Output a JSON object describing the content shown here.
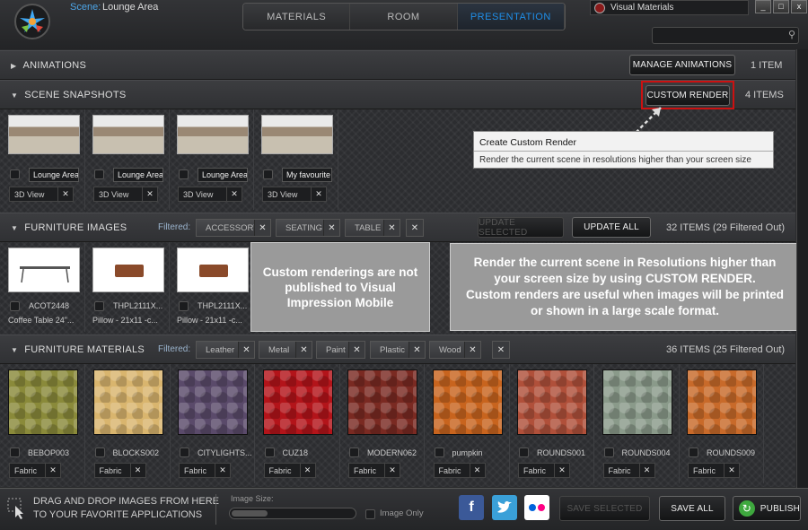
{
  "header": {
    "scene_label": "Scene:",
    "scene_name": "Lounge Area",
    "tabs": [
      "MATERIALS",
      "ROOM",
      "PRESENTATION"
    ],
    "active_tab": "PRESENTATION",
    "app_tab": "Visual Materials",
    "win_buttons": [
      "_",
      "□",
      "x"
    ],
    "search": {
      "placeholder": ""
    }
  },
  "animations": {
    "title": "ANIMATIONS",
    "button": "MANAGE ANIMATIONS",
    "count": "1 ITEM"
  },
  "snapshots": {
    "title": "SCENE SNAPSHOTS",
    "button": "CUSTOM RENDER",
    "count": "4 ITEMS",
    "items": [
      {
        "name": "Lounge Area",
        "view": "3D View"
      },
      {
        "name": "Lounge Area",
        "view": "3D View"
      },
      {
        "name": "Lounge Area",
        "view": "3D View"
      },
      {
        "name": "My favourite",
        "view": "3D View"
      }
    ]
  },
  "tooltip": {
    "title": "Create Custom Render",
    "text": "Render the current scene in resolutions higher than your screen size"
  },
  "furniture_images": {
    "title": "FURNITURE IMAGES",
    "filtered": "Filtered:",
    "filters": [
      "ACCESSORY",
      "SEATING",
      "TABLE"
    ],
    "update_selected": "UPDATE SELECTED",
    "update_all": "UPDATE ALL",
    "count": "32 ITEMS (29 Filtered Out)",
    "items": [
      {
        "code": "ACOT2448",
        "desc": "Coffee Table 24\"..."
      },
      {
        "code": "THPL2111X...",
        "desc": "Pillow - 21x11 -c..."
      },
      {
        "code": "THPL2111X...",
        "desc": "Pillow - 21x11 -c..."
      }
    ]
  },
  "callout_left": "Custom renderings are not published to Visual Impression Mobile",
  "callout_right": "Render the current scene in Resolutions higher than your screen size by using CUSTOM RENDER.\nCustom renders are useful when images will be printed or shown in a large scale format.",
  "furniture_materials": {
    "title": "FURNITURE MATERIALS",
    "filtered": "Filtered:",
    "filters": [
      "Leather",
      "Metal",
      "Paint",
      "Plastic",
      "Wood"
    ],
    "count": "36 ITEMS (25 Filtered Out)",
    "items": [
      {
        "name": "BEBOP003",
        "type": "Fabric",
        "color": "#8a8a3a"
      },
      {
        "name": "BLOCKS002",
        "type": "Fabric",
        "color": "#d9b56e"
      },
      {
        "name": "CITYLIGHTS...",
        "type": "Fabric",
        "color": "#5a4a6a"
      },
      {
        "name": "CUZ18",
        "type": "Fabric",
        "color": "#b3141a"
      },
      {
        "name": "MODERN062",
        "type": "Fabric",
        "color": "#7a2a22"
      },
      {
        "name": "pumpkin",
        "type": "Fabric",
        "color": "#c8641e"
      },
      {
        "name": "ROUNDS001",
        "type": "Fabric",
        "color": "#b0503a"
      },
      {
        "name": "ROUNDS004",
        "type": "Fabric",
        "color": "#8a9a8a"
      },
      {
        "name": "ROUNDS009",
        "type": "Fabric",
        "color": "#c86a2a"
      }
    ]
  },
  "footer": {
    "drag_text_1": "DRAG AND DROP IMAGES FROM HERE",
    "drag_text_2": "TO YOUR FAVORITE APPLICATIONS",
    "image_size": "Image Size:",
    "image_only": "Image Only",
    "save_selected": "SAVE SELECTED",
    "save_all": "SAVE ALL",
    "publish": "PUBLISH",
    "facebook": "f"
  }
}
